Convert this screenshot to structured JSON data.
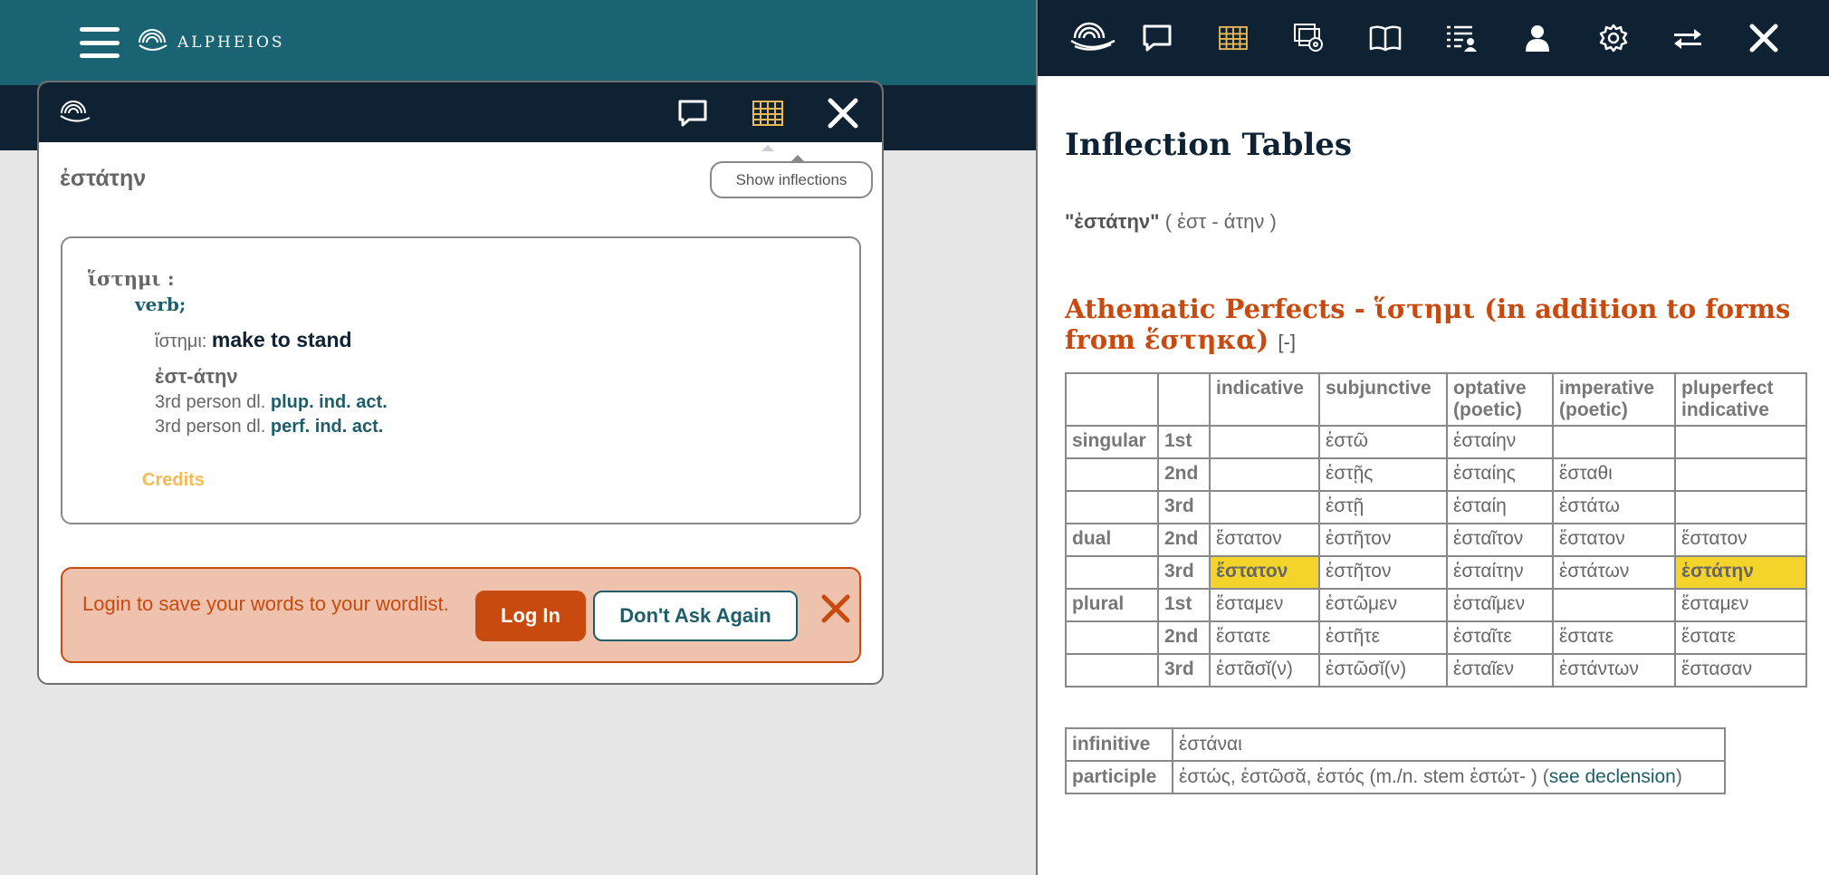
{
  "site": {
    "logo_text": "ALPHEIOS"
  },
  "popup": {
    "target_word": "ἐστάτην",
    "tooltip": "Show inflections",
    "lexeme": {
      "lemma": "ἵστημι :",
      "pos": "verb;",
      "def_lemma": "ἵστημι:",
      "definition": "make to stand",
      "form": "ἐστ-άτην",
      "inflections": [
        {
          "prefix": "3rd person dl.",
          "value": "plup. ind. act."
        },
        {
          "prefix": "3rd person dl.",
          "value": "perf. ind. act."
        }
      ],
      "credits": "Credits"
    },
    "login_banner": {
      "text": "Login to save your words to your wordlist.",
      "login_label": "Log In",
      "dont_ask_label": "Don't Ask Again"
    }
  },
  "panel": {
    "title": "Inflection Tables",
    "word": "\"ἐστάτην\"",
    "word_parts": "( ἐστ - άτην )",
    "table_title": "Athematic Perfects - ἵστημι (in addition to forms from ἕστηκα)",
    "collapse": "[-]",
    "headers": [
      "indicative",
      "subjunctive",
      "optative (poetic)",
      "imperative (poetic)",
      "pluperfect indicative"
    ],
    "rows": [
      {
        "number": "singular",
        "person": "1st",
        "cells": [
          "",
          "ἑστῶ",
          "ἑσταίην",
          "",
          ""
        ]
      },
      {
        "number": "",
        "person": "2nd",
        "cells": [
          "",
          "ἑστῇς",
          "ἑσταίης",
          "ἕσταθι",
          ""
        ]
      },
      {
        "number": "",
        "person": "3rd",
        "cells": [
          "",
          "ἑστῇ",
          "ἑσταίη",
          "ἑστάτω",
          ""
        ]
      },
      {
        "number": "dual",
        "person": "2nd",
        "cells": [
          "ἕστατον",
          "ἑστῆτον",
          "ἑσταῖτον",
          "ἕστατον",
          "ἕστατον"
        ]
      },
      {
        "number": "",
        "person": "3rd",
        "cells": [
          "ἕστατον",
          "ἑστῆτον",
          "ἑσταίτην",
          "ἑστάτων",
          "ἑστάτην"
        ]
      },
      {
        "number": "plural",
        "person": "1st",
        "cells": [
          "ἕσταμεν",
          "ἑστῶμεν",
          "ἑσταῖμεν",
          "",
          "ἕσταμεν"
        ]
      },
      {
        "number": "",
        "person": "2nd",
        "cells": [
          "ἕστατε",
          "ἑστῆτε",
          "ἑσταῖτε",
          "ἕστατε",
          "ἕστατε"
        ]
      },
      {
        "number": "",
        "person": "3rd",
        "cells": [
          "ἑστᾶσῐ(ν)",
          "ἑστῶσῐ(ν)",
          "ἑσταῖεν",
          "ἑστάντων",
          "ἕστασαν"
        ]
      }
    ],
    "nonfinite": {
      "infinitive_label": "infinitive",
      "infinitive_value": "ἑστάναι",
      "participle_label": "participle",
      "participle_value": "ἑστώς, ἑστῶσᾰ, ἑστός (m./n. stem ἑστώτ- ) (",
      "participle_link": "see declension",
      "participle_close": ")"
    }
  }
}
